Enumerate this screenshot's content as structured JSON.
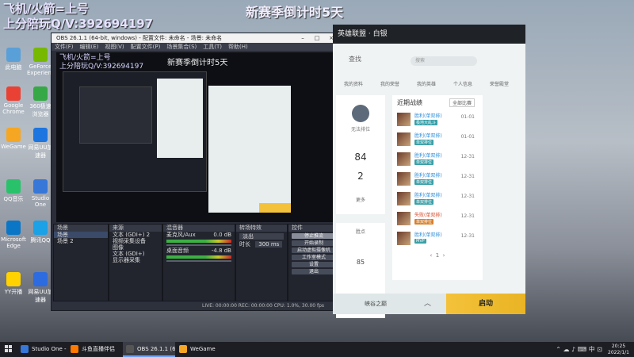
{
  "overlay": {
    "line1": "飞机/火箭=上号",
    "line2": "上分陪玩Q/V:392694197",
    "center": "新赛季倒计时5天"
  },
  "desktop_icons": [
    {
      "label": "此电脑",
      "color": "#5aa0d8"
    },
    {
      "label": "GeForce Experience",
      "color": "#76b900"
    },
    {
      "label": "Google Chrome",
      "color": "#e94235"
    },
    {
      "label": "360极速浏览器",
      "color": "#36a845"
    },
    {
      "label": "WeGame",
      "color": "#f5a623"
    },
    {
      "label": "网易UU加速器",
      "color": "#1d75e0"
    },
    {
      "label": "QQ音乐",
      "color": "#29c26b"
    },
    {
      "label": "Studio One",
      "color": "#3677d8"
    },
    {
      "label": "Microsoft Edge",
      "color": "#0b76c5"
    },
    {
      "label": "腾讯QQ",
      "color": "#1aa1e6"
    },
    {
      "label": "YY开播",
      "color": "#ffd200"
    },
    {
      "label": "网易UU加速器",
      "color": "#2d6be0"
    }
  ],
  "obs": {
    "title": "OBS 26.1.1 (64-bit, windows) - 配置文件: 未命名 - 场景: 未命名",
    "menu": [
      "文件(F)",
      "编辑(E)",
      "视图(V)",
      "配置文件(P)",
      "场景集合(S)",
      "工具(T)",
      "帮助(H)"
    ],
    "preview_line1": "飞机/火箭=上号",
    "preview_line2": "上分陪玩Q/V:392694197",
    "preview_center": "新赛季倒计时5天",
    "scenes_header": "场景",
    "scenes": [
      "场景",
      "场景 2"
    ],
    "sources_header": "来源",
    "sources": [
      "文本 (GDI+) 2",
      "视频采集设备",
      "图像",
      "文本 (GDI+)",
      "显示器采集"
    ],
    "mixer_header": "混音器",
    "mixer": [
      {
        "name": "麦克风/Aux",
        "db": "0.0 dB"
      },
      {
        "name": "桌面音频",
        "db": "-4.8 dB"
      }
    ],
    "transitions_header": "转场特效",
    "transition_type": "淡出",
    "duration_label": "时长",
    "duration": "300 ms",
    "controls_header": "控件",
    "controls": [
      "停止推流",
      "开始录制",
      "启动虚拟摄像机",
      "工作室模式",
      "设置",
      "退出"
    ],
    "status": "LIVE: 00:00:00   REC: 00:00:00   CPU: 1.0%, 30.00 fps",
    "selected_control": "停止推流"
  },
  "wegame": {
    "brand": "英雄联盟 · 白银",
    "search_placeholder": "搜索",
    "nav_title": "查找",
    "tabs": [
      "我的资料",
      "我的荣誉",
      "我的英雄",
      "个人信息",
      "荣誉殿堂"
    ],
    "rank_label": "无法排位",
    "stat_a": "84",
    "stat_b": "2",
    "more": "更多",
    "records_title": "近期战绩",
    "records_filter": "全部比赛",
    "records": [
      {
        "result": "胜利(单双排)",
        "tag": "极地大乱斗",
        "date": "01-01",
        "win": true
      },
      {
        "result": "胜利(单双排)",
        "tag": "单双排位",
        "date": "01-01",
        "win": true
      },
      {
        "result": "胜利(单双排)",
        "tag": "单双排位",
        "date": "12-31",
        "win": true
      },
      {
        "result": "胜利(单双排)",
        "tag": "单双排位",
        "date": "12-31",
        "win": true
      },
      {
        "result": "胜利(单双排)",
        "tag": "单双排位",
        "date": "12-31",
        "win": true
      },
      {
        "result": "失败(单双排)",
        "tag": "单双排位",
        "date": "12-31",
        "win": false
      },
      {
        "result": "胜利(单双排)",
        "tag": "MVP",
        "date": "12-31",
        "win": true
      }
    ],
    "mode": "峡谷之巅",
    "launch": "启动",
    "score_label": "胜点",
    "score": "85"
  },
  "taskbar": {
    "items": [
      {
        "label": "Studio One - 上载...",
        "color": "#3677d8"
      },
      {
        "label": "斗鱼直播伴侣",
        "color": "#ff7800"
      },
      {
        "label": "OBS 26.1.1 (64-bi...",
        "color": "#555555"
      },
      {
        "label": "WeGame",
        "color": "#f5a623"
      }
    ],
    "time": "20:25",
    "date": "2022/1/1"
  },
  "colors": {
    "accent": "#f4c23a",
    "win": "#2a8bd8",
    "loss": "#d84a2a"
  }
}
